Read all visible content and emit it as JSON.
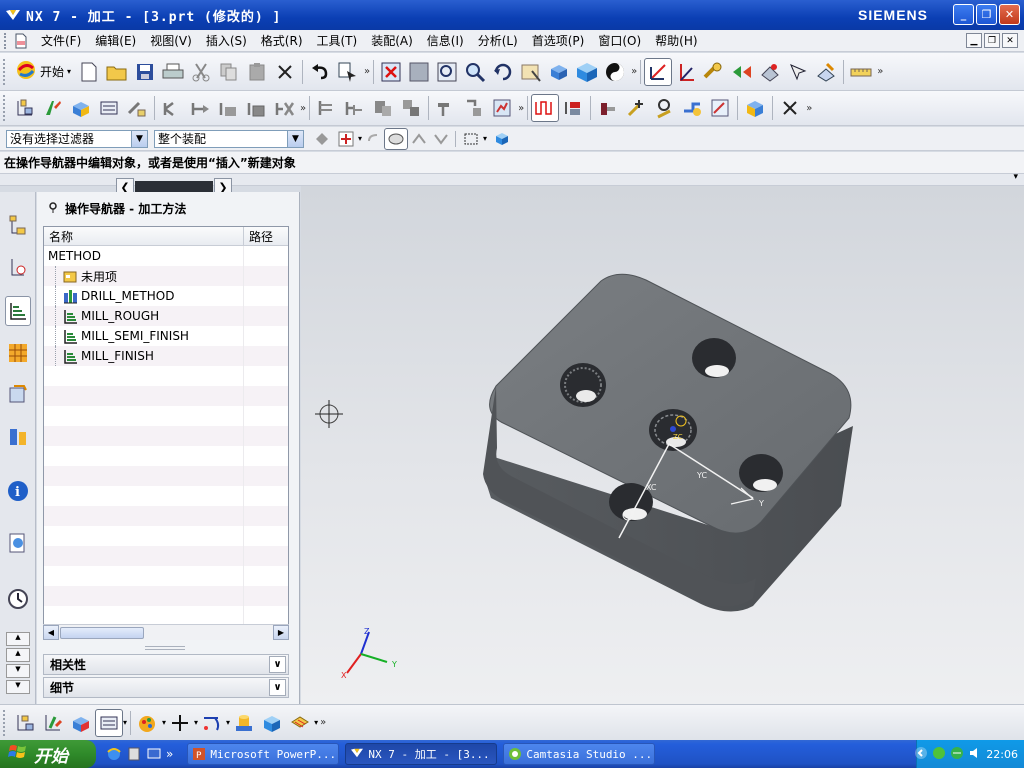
{
  "window": {
    "title": "NX 7 - 加工 - [3.prt (修改的) ]",
    "brand": "SIEMENS",
    "minimize": "_",
    "maximize": "❐",
    "close": "✕"
  },
  "menu": {
    "items": [
      "文件(F)",
      "编辑(E)",
      "视图(V)",
      "插入(S)",
      "格式(R)",
      "工具(T)",
      "装配(A)",
      "信息(I)",
      "分析(L)",
      "首选项(P)",
      "窗口(O)",
      "帮助(H)"
    ]
  },
  "toolbar": {
    "start_label": "开始"
  },
  "filter": {
    "selection_filter": "没有选择过滤器",
    "scope": "整个装配"
  },
  "status": {
    "text": "在操作导航器中编辑对象，或者是使用“插入”新建对象"
  },
  "navigator": {
    "title": "操作导航器 - 加工方法",
    "columns": [
      "名称",
      "路径"
    ],
    "rows": [
      {
        "label": "METHOD",
        "level": 0,
        "icon": "none"
      },
      {
        "label": "未用项",
        "level": 1,
        "icon": "folder-icon"
      },
      {
        "label": "DRILL_METHOD",
        "level": 1,
        "icon": "drill-method-icon"
      },
      {
        "label": "MILL_ROUGH",
        "level": 1,
        "icon": "mill-method-icon"
      },
      {
        "label": "MILL_SEMI_FINISH",
        "level": 1,
        "icon": "mill-method-icon"
      },
      {
        "label": "MILL_FINISH",
        "level": 1,
        "icon": "mill-method-icon"
      }
    ],
    "sections": [
      "相关性",
      "细节"
    ]
  },
  "viewport": {
    "axis_labels": {
      "x": "X",
      "y": "Y",
      "z": "Z"
    },
    "wcs_labels": {
      "xc": "XC",
      "yc": "YC",
      "zc": "ZC",
      "y": "Y"
    },
    "colors": {
      "part": "#6e7276",
      "part_edge": "#45484c",
      "triad_x": "#e02020",
      "triad_y": "#16b026",
      "triad_z": "#2030d0"
    }
  },
  "taskbar": {
    "start_label": "开始",
    "tasks": [
      {
        "label": "Microsoft PowerP...",
        "active": false
      },
      {
        "label": "NX 7 - 加工 - [3...",
        "active": true
      },
      {
        "label": "Camtasia Studio ...",
        "active": false
      }
    ],
    "more_arrows": "»",
    "clock": "22:06"
  }
}
